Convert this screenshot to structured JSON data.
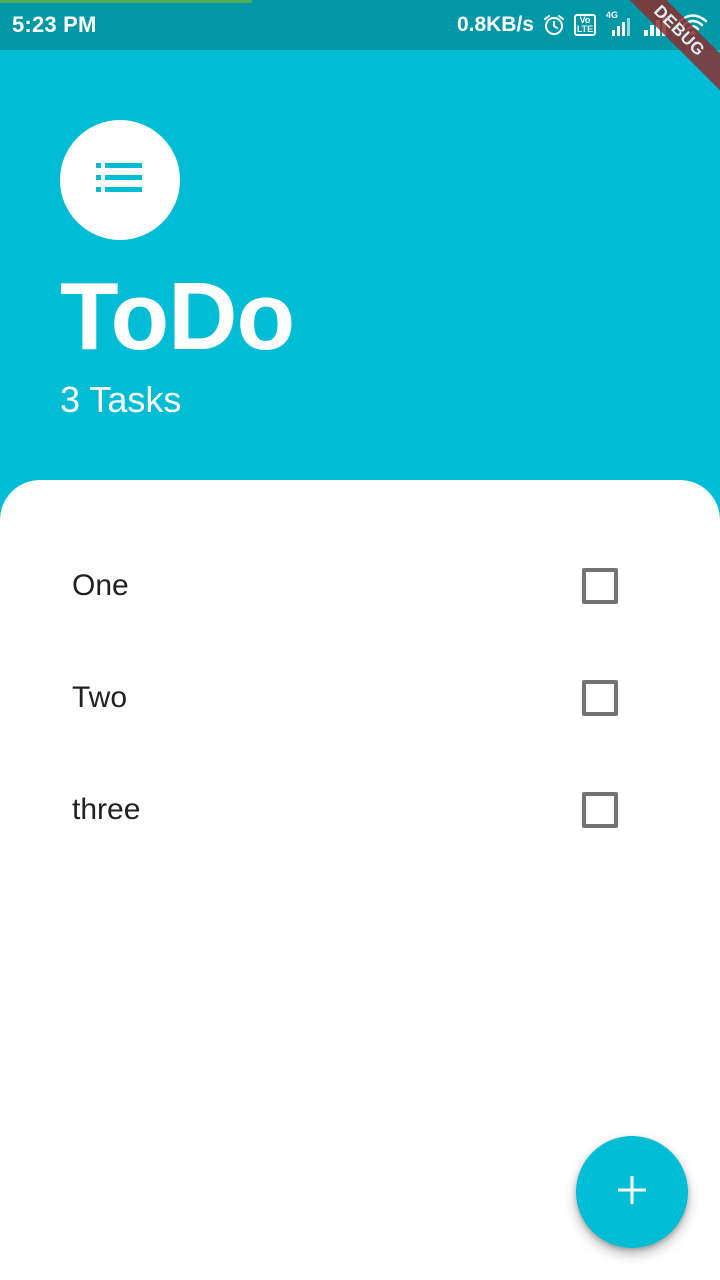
{
  "status_bar": {
    "time": "5:23 PM",
    "net_speed": "0.8KB/s",
    "volte_top": "Vo",
    "volte_bottom": "LTE",
    "network_type": "4G",
    "icons": [
      "alarm-icon",
      "volte-icon",
      "signal-4g-icon",
      "signal-icon",
      "wifi-icon"
    ]
  },
  "debug_banner": "DEBUG",
  "header": {
    "icon": "list-icon",
    "title": "ToDo",
    "task_count": "3 Tasks"
  },
  "tasks": [
    {
      "label": "One",
      "checked": false
    },
    {
      "label": "Two",
      "checked": false
    },
    {
      "label": "three",
      "checked": false
    }
  ],
  "fab": {
    "icon": "add-icon"
  },
  "colors": {
    "primary": "#00BCD4",
    "status_bar": "#0097A7",
    "text_dark": "#212121",
    "checkbox_border": "#737373",
    "debug_banner": "#8B2F2F"
  }
}
